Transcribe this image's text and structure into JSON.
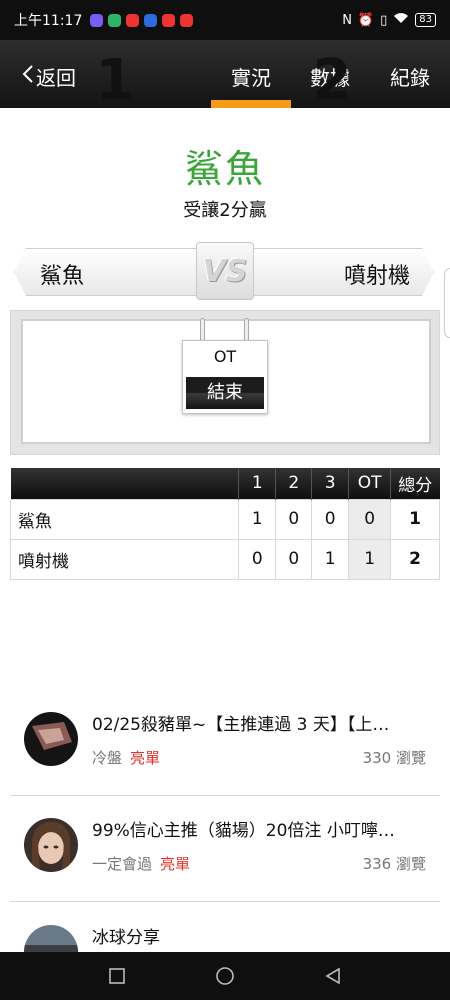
{
  "status_bar": {
    "time": "上午11:17",
    "battery": "83"
  },
  "nav": {
    "back_label": "返回",
    "tabs": [
      "實況",
      "數據",
      "紀錄"
    ],
    "active_tab": 0
  },
  "winner": {
    "team": "鯊魚",
    "note": "受讓2分贏"
  },
  "matchup": {
    "home": "鯊魚",
    "away": "噴射機",
    "vs": "VS"
  },
  "score": {
    "home": "1",
    "away": "2",
    "period": "OT",
    "state": "結束"
  },
  "box_score": {
    "headers": [
      "",
      "1",
      "2",
      "3",
      "OT",
      "總分"
    ],
    "rows": [
      {
        "team": "鯊魚",
        "p1": "1",
        "p2": "0",
        "p3": "0",
        "ot": "0",
        "total": "1"
      },
      {
        "team": "噴射機",
        "p1": "0",
        "p2": "0",
        "p3": "1",
        "ot": "1",
        "total": "2"
      }
    ]
  },
  "articles": [
    {
      "title": "02/25殺豬單~【主推連過 3 天】【上…",
      "author": "冷盤",
      "tag": "亮單",
      "views": "330 瀏覽"
    },
    {
      "title": "99%信心主推（貓場）20倍注 小叮嚀…",
      "author": "一定會過",
      "tag": "亮單",
      "views": "336 瀏覽"
    },
    {
      "title": "冰球分享",
      "author": "",
      "tag": "",
      "views": ""
    }
  ],
  "colors": {
    "accent": "#f39c1a",
    "winner": "#3aa63a",
    "hot": "#e0342c"
  }
}
